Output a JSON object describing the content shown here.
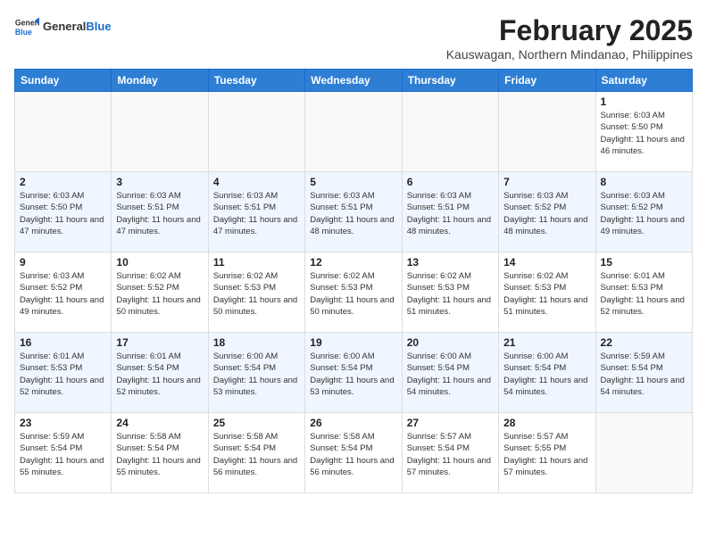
{
  "header": {
    "logo_general": "General",
    "logo_blue": "Blue",
    "month_year": "February 2025",
    "location": "Kauswagan, Northern Mindanao, Philippines"
  },
  "weekdays": [
    "Sunday",
    "Monday",
    "Tuesday",
    "Wednesday",
    "Thursday",
    "Friday",
    "Saturday"
  ],
  "weeks": [
    [
      {
        "day": "",
        "info": ""
      },
      {
        "day": "",
        "info": ""
      },
      {
        "day": "",
        "info": ""
      },
      {
        "day": "",
        "info": ""
      },
      {
        "day": "",
        "info": ""
      },
      {
        "day": "",
        "info": ""
      },
      {
        "day": "1",
        "info": "Sunrise: 6:03 AM\nSunset: 5:50 PM\nDaylight: 11 hours and 46 minutes."
      }
    ],
    [
      {
        "day": "2",
        "info": "Sunrise: 6:03 AM\nSunset: 5:50 PM\nDaylight: 11 hours and 47 minutes."
      },
      {
        "day": "3",
        "info": "Sunrise: 6:03 AM\nSunset: 5:51 PM\nDaylight: 11 hours and 47 minutes."
      },
      {
        "day": "4",
        "info": "Sunrise: 6:03 AM\nSunset: 5:51 PM\nDaylight: 11 hours and 47 minutes."
      },
      {
        "day": "5",
        "info": "Sunrise: 6:03 AM\nSunset: 5:51 PM\nDaylight: 11 hours and 48 minutes."
      },
      {
        "day": "6",
        "info": "Sunrise: 6:03 AM\nSunset: 5:51 PM\nDaylight: 11 hours and 48 minutes."
      },
      {
        "day": "7",
        "info": "Sunrise: 6:03 AM\nSunset: 5:52 PM\nDaylight: 11 hours and 48 minutes."
      },
      {
        "day": "8",
        "info": "Sunrise: 6:03 AM\nSunset: 5:52 PM\nDaylight: 11 hours and 49 minutes."
      }
    ],
    [
      {
        "day": "9",
        "info": "Sunrise: 6:03 AM\nSunset: 5:52 PM\nDaylight: 11 hours and 49 minutes."
      },
      {
        "day": "10",
        "info": "Sunrise: 6:02 AM\nSunset: 5:52 PM\nDaylight: 11 hours and 50 minutes."
      },
      {
        "day": "11",
        "info": "Sunrise: 6:02 AM\nSunset: 5:53 PM\nDaylight: 11 hours and 50 minutes."
      },
      {
        "day": "12",
        "info": "Sunrise: 6:02 AM\nSunset: 5:53 PM\nDaylight: 11 hours and 50 minutes."
      },
      {
        "day": "13",
        "info": "Sunrise: 6:02 AM\nSunset: 5:53 PM\nDaylight: 11 hours and 51 minutes."
      },
      {
        "day": "14",
        "info": "Sunrise: 6:02 AM\nSunset: 5:53 PM\nDaylight: 11 hours and 51 minutes."
      },
      {
        "day": "15",
        "info": "Sunrise: 6:01 AM\nSunset: 5:53 PM\nDaylight: 11 hours and 52 minutes."
      }
    ],
    [
      {
        "day": "16",
        "info": "Sunrise: 6:01 AM\nSunset: 5:53 PM\nDaylight: 11 hours and 52 minutes."
      },
      {
        "day": "17",
        "info": "Sunrise: 6:01 AM\nSunset: 5:54 PM\nDaylight: 11 hours and 52 minutes."
      },
      {
        "day": "18",
        "info": "Sunrise: 6:00 AM\nSunset: 5:54 PM\nDaylight: 11 hours and 53 minutes."
      },
      {
        "day": "19",
        "info": "Sunrise: 6:00 AM\nSunset: 5:54 PM\nDaylight: 11 hours and 53 minutes."
      },
      {
        "day": "20",
        "info": "Sunrise: 6:00 AM\nSunset: 5:54 PM\nDaylight: 11 hours and 54 minutes."
      },
      {
        "day": "21",
        "info": "Sunrise: 6:00 AM\nSunset: 5:54 PM\nDaylight: 11 hours and 54 minutes."
      },
      {
        "day": "22",
        "info": "Sunrise: 5:59 AM\nSunset: 5:54 PM\nDaylight: 11 hours and 54 minutes."
      }
    ],
    [
      {
        "day": "23",
        "info": "Sunrise: 5:59 AM\nSunset: 5:54 PM\nDaylight: 11 hours and 55 minutes."
      },
      {
        "day": "24",
        "info": "Sunrise: 5:58 AM\nSunset: 5:54 PM\nDaylight: 11 hours and 55 minutes."
      },
      {
        "day": "25",
        "info": "Sunrise: 5:58 AM\nSunset: 5:54 PM\nDaylight: 11 hours and 56 minutes."
      },
      {
        "day": "26",
        "info": "Sunrise: 5:58 AM\nSunset: 5:54 PM\nDaylight: 11 hours and 56 minutes."
      },
      {
        "day": "27",
        "info": "Sunrise: 5:57 AM\nSunset: 5:54 PM\nDaylight: 11 hours and 57 minutes."
      },
      {
        "day": "28",
        "info": "Sunrise: 5:57 AM\nSunset: 5:55 PM\nDaylight: 11 hours and 57 minutes."
      },
      {
        "day": "",
        "info": ""
      }
    ]
  ]
}
